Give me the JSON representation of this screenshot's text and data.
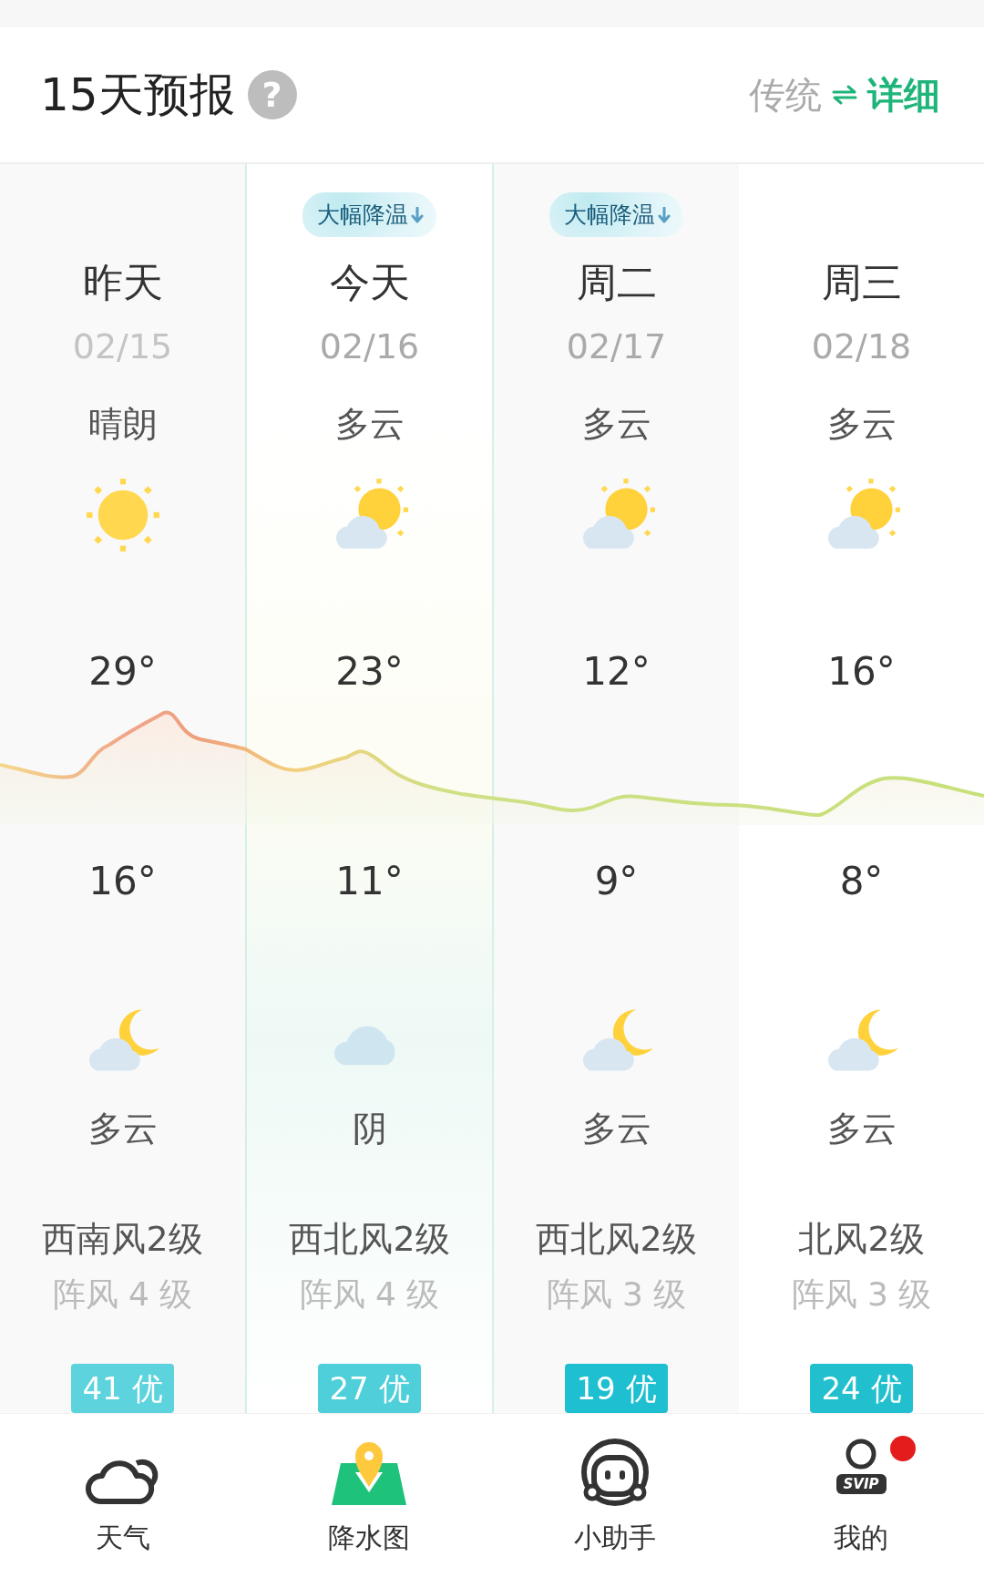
{
  "header": {
    "title": "15天预报",
    "help_mark": "?",
    "modes": [
      {
        "label": "传统",
        "selected": false
      },
      {
        "label": "详细",
        "selected": true
      }
    ]
  },
  "days": [
    {
      "name": "昨天",
      "date": "02/15",
      "day": {
        "condition": "晴朗",
        "kind": "sunny"
      },
      "high": "29°",
      "low": "16°",
      "night": {
        "condition": "多云",
        "kind": "moon-cloud"
      },
      "wind": "西南风2级",
      "gust": "阵风 4 级",
      "aqi": {
        "text": "41 优",
        "color": "#5dd3dd"
      },
      "selected": false,
      "past": true
    },
    {
      "alert": "大幅降温",
      "name": "今天",
      "date": "02/16",
      "day": {
        "condition": "多云",
        "kind": "suncloud"
      },
      "high": "23°",
      "low": "11°",
      "night": {
        "condition": "阴",
        "kind": "cloud"
      },
      "wind": "西北风2级",
      "gust": "阵风 4 级",
      "aqi": {
        "text": "27 优",
        "color": "#4fcfd9"
      },
      "selected": true,
      "past": false
    },
    {
      "alert": "大幅降温",
      "name": "周二",
      "date": "02/17",
      "day": {
        "condition": "多云",
        "kind": "suncloud"
      },
      "high": "12°",
      "low": "9°",
      "night": {
        "condition": "多云",
        "kind": "moon-cloud"
      },
      "wind": "西北风2级",
      "gust": "阵风 3 级",
      "aqi": {
        "text": "19 优",
        "color": "#1dbfd0"
      },
      "selected": false,
      "past": false
    },
    {
      "name": "周三",
      "date": "02/18",
      "day": {
        "condition": "多云",
        "kind": "suncloud"
      },
      "high": "16°",
      "low": "8°",
      "night": {
        "condition": "多云",
        "kind": "moon-cloud"
      },
      "wind": "北风2级",
      "gust": "阵风 3 级",
      "aqi": {
        "text": "24 优",
        "color": "#22c0cf"
      },
      "selected": false,
      "past": false
    }
  ],
  "nav": [
    {
      "label": "天气",
      "kind": "weather",
      "dot": false
    },
    {
      "label": "降水图",
      "kind": "map",
      "dot": false
    },
    {
      "label": "小助手",
      "kind": "assistant",
      "dot": false
    },
    {
      "label": "我的",
      "kind": "profile",
      "dot": true,
      "tag": "SVIP"
    }
  ]
}
